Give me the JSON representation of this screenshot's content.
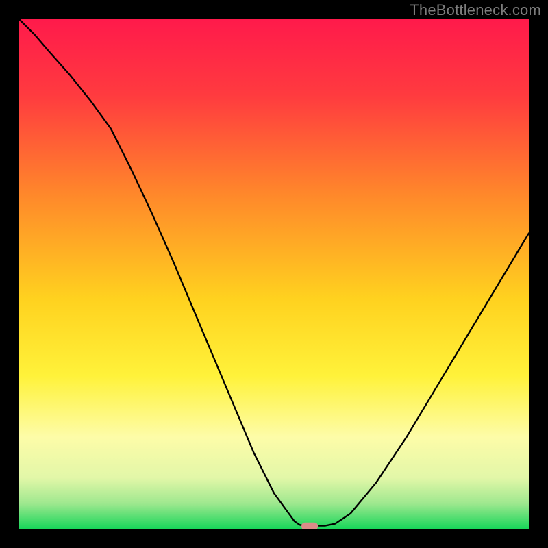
{
  "watermark": "TheBottleneck.com",
  "chart_data": {
    "type": "line",
    "title": "",
    "xlabel": "",
    "ylabel": "",
    "xlim": [
      0,
      100
    ],
    "ylim": [
      0,
      100
    ],
    "x": [
      0,
      3,
      6,
      10,
      14,
      18,
      22,
      26,
      30,
      34,
      38,
      42,
      46,
      50,
      54,
      55,
      56,
      57,
      58,
      60,
      62,
      65,
      70,
      76,
      82,
      88,
      94,
      100
    ],
    "values": [
      100,
      97,
      93.5,
      89,
      84,
      78.5,
      70.5,
      62,
      53,
      43.5,
      34,
      24.5,
      15,
      7,
      1.5,
      0.8,
      0.5,
      0.5,
      0.6,
      0.6,
      1,
      3,
      9,
      18,
      28,
      38,
      48,
      58
    ],
    "series": [
      {
        "name": "bottleneck-curve",
        "x_ref": "x",
        "y_ref": "values"
      }
    ],
    "marker": {
      "x": 57,
      "y": 0.5
    },
    "gradient_stops": [
      {
        "offset": 0,
        "color": "#ff1a4b"
      },
      {
        "offset": 0.15,
        "color": "#ff3b3f"
      },
      {
        "offset": 0.35,
        "color": "#ff8a2a"
      },
      {
        "offset": 0.55,
        "color": "#ffd21f"
      },
      {
        "offset": 0.7,
        "color": "#fff23a"
      },
      {
        "offset": 0.82,
        "color": "#fdfca8"
      },
      {
        "offset": 0.9,
        "color": "#e2f7a8"
      },
      {
        "offset": 0.95,
        "color": "#9fe88f"
      },
      {
        "offset": 1.0,
        "color": "#18d65a"
      }
    ]
  }
}
